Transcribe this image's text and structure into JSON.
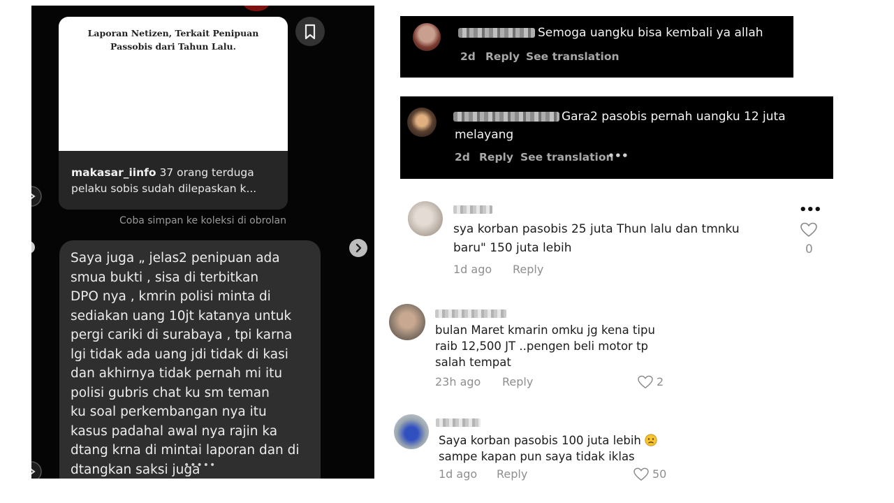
{
  "left": {
    "post_image_title": "Laporan Netizen, Terkait Penipuan Passobis dari Tahun Lalu.",
    "post_username": "makasar_iinfo",
    "post_caption": "37 orang terduga pelaku sobis sudah dilepaskan k...",
    "hint": "Coba simpan ke koleksi di obrolan",
    "message": "Saya juga „ jelas2 penipuan ada\nsmua bukti , sisa di terbitkan\nDPO nya , kmrin polisi minta di\nsediakan uang 10jt katanya untuk\npergi cariki di surabaya , tpi karna\nlgi tidak ada uang jdi tidak di kasi\ndan akhirnya tidak pernah mi itu\npolisi gubris chat ku sm teman\nku soal perkembangan nya itu\nkasus padahal awal nya rajin ka\ndtang krna di mintai laporan dan di\ndtangkan saksi juga",
    "dots": "•••••"
  },
  "comments_dark": [
    {
      "text": "Semoga uangku bisa kembali ya allah",
      "time": "2d",
      "reply": "Reply",
      "translate": "See translation"
    },
    {
      "text_line1": "Gara2 pasobis pernah uangku 12 juta",
      "text_line2": "melayang",
      "time": "2d",
      "reply": "Reply",
      "translate": "See translation",
      "more": "•••"
    }
  ],
  "comments_light": [
    {
      "text_line1": "sya korban pasobis 25 juta Thun lalu dan tmnku",
      "text_line2": "baru\" 150 juta lebih",
      "time": "1d ago",
      "reply": "Reply",
      "likes": "0",
      "more": "•••"
    },
    {
      "text_line1": "bulan Maret kmarin omku jg kena tipu",
      "text_line2": "raib 12,500 JT ..pengen beli motor tp",
      "text_line3": "salah tempat",
      "time": "23h ago",
      "reply": "Reply",
      "likes": "2"
    },
    {
      "text_line1": "Saya korban pasobis 100 juta lebih",
      "text_line2": "sampe kapan pun saya tidak iklas",
      "time": "1d ago",
      "reply": "Reply",
      "likes": "50"
    }
  ],
  "icons": [
    "bookmark-icon",
    "chevron-right-icon",
    "heart-icon",
    "more-icon",
    "sad-face-emoji"
  ]
}
